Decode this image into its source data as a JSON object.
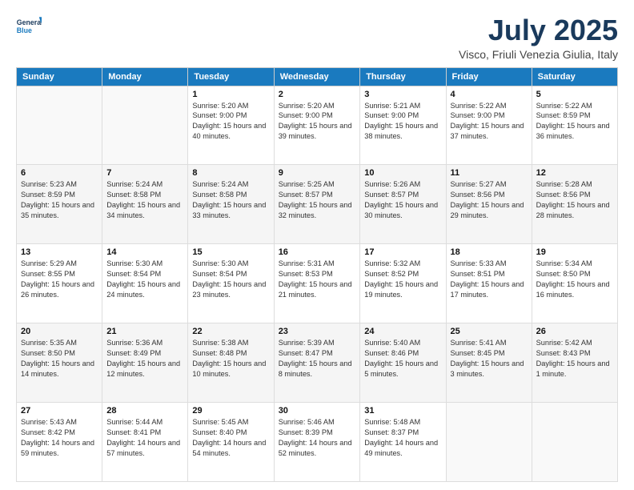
{
  "logo": {
    "line1": "General",
    "line2": "Blue"
  },
  "title": "July 2025",
  "location": "Visco, Friuli Venezia Giulia, Italy",
  "headers": [
    "Sunday",
    "Monday",
    "Tuesday",
    "Wednesday",
    "Thursday",
    "Friday",
    "Saturday"
  ],
  "weeks": [
    [
      {
        "day": "",
        "info": ""
      },
      {
        "day": "",
        "info": ""
      },
      {
        "day": "1",
        "info": "Sunrise: 5:20 AM\nSunset: 9:00 PM\nDaylight: 15 hours and 40 minutes."
      },
      {
        "day": "2",
        "info": "Sunrise: 5:20 AM\nSunset: 9:00 PM\nDaylight: 15 hours and 39 minutes."
      },
      {
        "day": "3",
        "info": "Sunrise: 5:21 AM\nSunset: 9:00 PM\nDaylight: 15 hours and 38 minutes."
      },
      {
        "day": "4",
        "info": "Sunrise: 5:22 AM\nSunset: 9:00 PM\nDaylight: 15 hours and 37 minutes."
      },
      {
        "day": "5",
        "info": "Sunrise: 5:22 AM\nSunset: 8:59 PM\nDaylight: 15 hours and 36 minutes."
      }
    ],
    [
      {
        "day": "6",
        "info": "Sunrise: 5:23 AM\nSunset: 8:59 PM\nDaylight: 15 hours and 35 minutes."
      },
      {
        "day": "7",
        "info": "Sunrise: 5:24 AM\nSunset: 8:58 PM\nDaylight: 15 hours and 34 minutes."
      },
      {
        "day": "8",
        "info": "Sunrise: 5:24 AM\nSunset: 8:58 PM\nDaylight: 15 hours and 33 minutes."
      },
      {
        "day": "9",
        "info": "Sunrise: 5:25 AM\nSunset: 8:57 PM\nDaylight: 15 hours and 32 minutes."
      },
      {
        "day": "10",
        "info": "Sunrise: 5:26 AM\nSunset: 8:57 PM\nDaylight: 15 hours and 30 minutes."
      },
      {
        "day": "11",
        "info": "Sunrise: 5:27 AM\nSunset: 8:56 PM\nDaylight: 15 hours and 29 minutes."
      },
      {
        "day": "12",
        "info": "Sunrise: 5:28 AM\nSunset: 8:56 PM\nDaylight: 15 hours and 28 minutes."
      }
    ],
    [
      {
        "day": "13",
        "info": "Sunrise: 5:29 AM\nSunset: 8:55 PM\nDaylight: 15 hours and 26 minutes."
      },
      {
        "day": "14",
        "info": "Sunrise: 5:30 AM\nSunset: 8:54 PM\nDaylight: 15 hours and 24 minutes."
      },
      {
        "day": "15",
        "info": "Sunrise: 5:30 AM\nSunset: 8:54 PM\nDaylight: 15 hours and 23 minutes."
      },
      {
        "day": "16",
        "info": "Sunrise: 5:31 AM\nSunset: 8:53 PM\nDaylight: 15 hours and 21 minutes."
      },
      {
        "day": "17",
        "info": "Sunrise: 5:32 AM\nSunset: 8:52 PM\nDaylight: 15 hours and 19 minutes."
      },
      {
        "day": "18",
        "info": "Sunrise: 5:33 AM\nSunset: 8:51 PM\nDaylight: 15 hours and 17 minutes."
      },
      {
        "day": "19",
        "info": "Sunrise: 5:34 AM\nSunset: 8:50 PM\nDaylight: 15 hours and 16 minutes."
      }
    ],
    [
      {
        "day": "20",
        "info": "Sunrise: 5:35 AM\nSunset: 8:50 PM\nDaylight: 15 hours and 14 minutes."
      },
      {
        "day": "21",
        "info": "Sunrise: 5:36 AM\nSunset: 8:49 PM\nDaylight: 15 hours and 12 minutes."
      },
      {
        "day": "22",
        "info": "Sunrise: 5:38 AM\nSunset: 8:48 PM\nDaylight: 15 hours and 10 minutes."
      },
      {
        "day": "23",
        "info": "Sunrise: 5:39 AM\nSunset: 8:47 PM\nDaylight: 15 hours and 8 minutes."
      },
      {
        "day": "24",
        "info": "Sunrise: 5:40 AM\nSunset: 8:46 PM\nDaylight: 15 hours and 5 minutes."
      },
      {
        "day": "25",
        "info": "Sunrise: 5:41 AM\nSunset: 8:45 PM\nDaylight: 15 hours and 3 minutes."
      },
      {
        "day": "26",
        "info": "Sunrise: 5:42 AM\nSunset: 8:43 PM\nDaylight: 15 hours and 1 minute."
      }
    ],
    [
      {
        "day": "27",
        "info": "Sunrise: 5:43 AM\nSunset: 8:42 PM\nDaylight: 14 hours and 59 minutes."
      },
      {
        "day": "28",
        "info": "Sunrise: 5:44 AM\nSunset: 8:41 PM\nDaylight: 14 hours and 57 minutes."
      },
      {
        "day": "29",
        "info": "Sunrise: 5:45 AM\nSunset: 8:40 PM\nDaylight: 14 hours and 54 minutes."
      },
      {
        "day": "30",
        "info": "Sunrise: 5:46 AM\nSunset: 8:39 PM\nDaylight: 14 hours and 52 minutes."
      },
      {
        "day": "31",
        "info": "Sunrise: 5:48 AM\nSunset: 8:37 PM\nDaylight: 14 hours and 49 minutes."
      },
      {
        "day": "",
        "info": ""
      },
      {
        "day": "",
        "info": ""
      }
    ]
  ]
}
